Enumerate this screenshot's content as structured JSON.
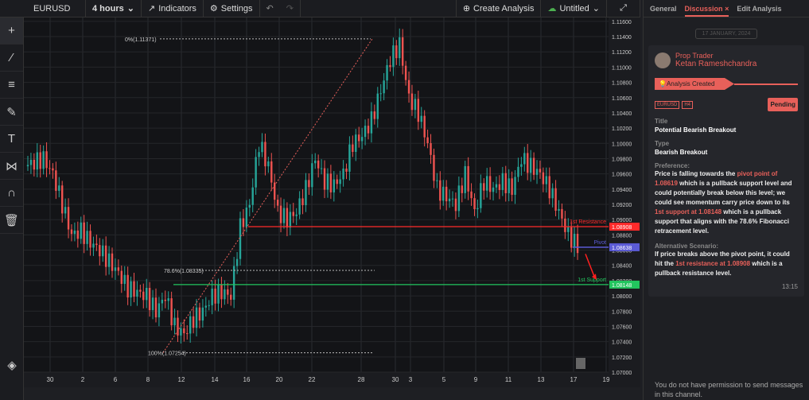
{
  "toolbar": {
    "symbol": "EURUSD",
    "interval": "4 hours",
    "indicators": "Indicators",
    "settings": "Settings",
    "create_analysis": "Create Analysis",
    "layout_name": "Untitled"
  },
  "left_tools": [
    "crosshair-icon",
    "trendline-icon",
    "fib-icon",
    "brush-icon",
    "text-icon",
    "pattern-icon",
    "magnet-icon",
    "trash-icon"
  ],
  "panel": {
    "tabs": [
      {
        "label": "General"
      },
      {
        "label": "Discussion",
        "active": true
      },
      {
        "label": "Edit Analysis"
      }
    ],
    "date": "17 JANUARY, 2024",
    "author_role": "Prop Trader",
    "author_name": "Ketan Rameshchandra",
    "event": "Analysis Created",
    "tags": [
      "EURUSD",
      "H4"
    ],
    "status": "Pending",
    "title_label": "Title",
    "title": "Potential Bearish Breakout",
    "type_label": "Type",
    "type": "Bearish Breakout",
    "pref_label": "Preference:",
    "pref": [
      "Price is falling towards the ",
      "pivot point of 1.08619",
      " which is a pullback support level and could potentially break below this level; we could see momentum carry price down to its ",
      "1st support at 1.08148",
      " which is a pullback support that aligns with the 78.6% Fibonacci retracement level."
    ],
    "alt_label": "Alternative Scenario:",
    "alt": [
      "If price breaks above the pivot point, it could hit the ",
      "1st resistance at 1.08908",
      " which is a pullback resistance level."
    ],
    "time": "13:15",
    "input_placeholder": "You do not have permission to send messages in this channel."
  },
  "colors": {
    "accent": "#e8605a",
    "up": "#26a69a",
    "down": "#ef5350",
    "resistance": "#ff2a2a",
    "support": "#22c55e",
    "pivot": "#5b5bd6"
  },
  "chart_data": {
    "type": "candlestick",
    "symbol": "EURUSD",
    "timeframe": "4 hours",
    "x_ticks": [
      "30",
      "2",
      "6",
      "8",
      "12",
      "14",
      "16",
      "20",
      "22",
      "28",
      "30",
      "3",
      "5",
      "9",
      "11",
      "13",
      "17",
      "19"
    ],
    "y_ticks": [
      "1.11600",
      "1.11400",
      "1.11200",
      "1.11000",
      "1.10800",
      "1.10600",
      "1.10400",
      "1.10200",
      "1.10000",
      "1.09800",
      "1.09600",
      "1.09400",
      "1.09200",
      "1.09000",
      "1.08800",
      "1.08600",
      "1.08400",
      "1.08200",
      "1.08000",
      "1.07800",
      "1.07600",
      "1.07400",
      "1.07200",
      "1.07000"
    ],
    "ylim": [
      1.07,
      1.1175
    ],
    "closes": [
      1.097,
      1.0975,
      1.098,
      1.096,
      1.092,
      1.088,
      1.0885,
      1.087,
      1.086,
      1.0845,
      1.083,
      1.081,
      1.0805,
      1.08,
      1.078,
      1.08,
      1.076,
      1.075,
      1.077,
      1.078,
      1.08,
      1.0805,
      1.08,
      1.089,
      1.092,
      1.1,
      1.097,
      1.091,
      1.09,
      1.091,
      1.094,
      1.098,
      1.095,
      1.0945,
      1.096,
      1.1,
      1.101,
      1.103,
      1.107,
      1.111,
      1.113,
      1.106,
      1.104,
      1.1,
      1.094,
      1.093,
      1.092,
      1.096,
      1.091,
      1.095,
      1.094,
      1.095,
      1.094,
      1.098,
      1.097,
      1.096,
      1.094,
      1.091,
      1.088,
      1.0865
    ],
    "levels": [
      {
        "label": "1st Resistance",
        "value": "1.08908",
        "price": 1.08908
      },
      {
        "label": "Pivot",
        "value": "1.08638",
        "price": 1.08638
      },
      {
        "label": "1st Support",
        "value": "1.08148",
        "price": 1.08148
      }
    ],
    "fib": [
      {
        "label": "0%(1.11371)",
        "price": 1.11371
      },
      {
        "label": "78.6%(1.08335)",
        "price": 1.08335
      },
      {
        "label": "100%(1.07254)",
        "price": 1.07254
      }
    ]
  }
}
